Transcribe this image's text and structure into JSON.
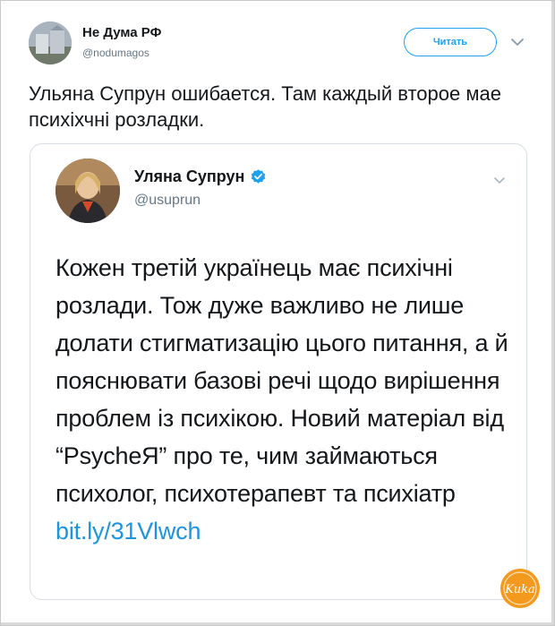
{
  "tweet": {
    "author_name": "Не Дума РФ",
    "author_handle": "@nodumagos",
    "follow_label": "Читать",
    "text": "Ульяна Супрун ошибается. Там каждый второе мае психіхчні розладки."
  },
  "quoted_tweet": {
    "author_name": "Уляна Супрун",
    "author_handle": "@usuprun",
    "verified": true,
    "text": "Кожен третій українець має психічні розлади. Тож дуже важливо не лише долати стигматизацію цього питання, а й пояснювати базові речі щодо вирішення проблем із психікою. Новий матеріал від “PsycheЯ” про те, чим займаються психолог, психотерапевт та психіатр",
    "link_text": "bit.ly/31Vlwch"
  },
  "watermark": {
    "text": "Kuka"
  },
  "colors": {
    "accent": "#1da1f2",
    "link": "#1b95e0",
    "secondary_text": "#657786",
    "watermark": "#f39a1e"
  },
  "icons": [
    "chevron-down-icon",
    "verified-badge-icon"
  ]
}
